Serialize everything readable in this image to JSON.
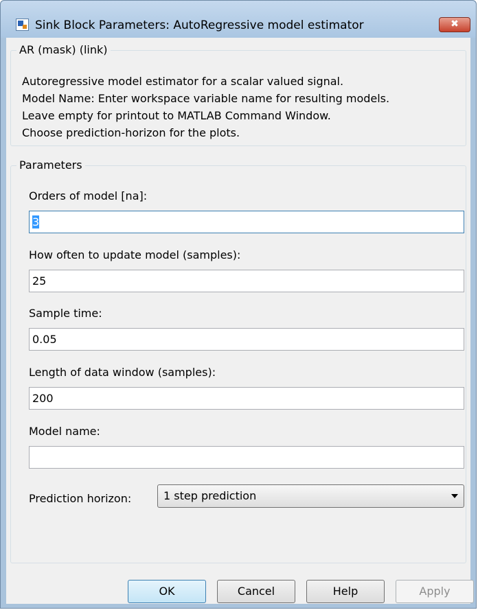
{
  "window": {
    "title": "Sink Block Parameters: AutoRegressive model estimator",
    "close_glyph": "✖"
  },
  "description_group": {
    "label": "AR (mask) (link)",
    "lines": [
      "Autoregressive model estimator for a scalar valued signal.",
      "Model Name: Enter workspace variable name for resulting models.",
      "Leave empty for printout to MATLAB Command Window.",
      "Choose prediction-horizon for the plots."
    ]
  },
  "parameters_group": {
    "label": "Parameters",
    "fields": [
      {
        "label": "Orders of model [na]:",
        "value": "3"
      },
      {
        "label": "How often to update model (samples):",
        "value": "25"
      },
      {
        "label": "Sample time:",
        "value": "0.05"
      },
      {
        "label": "Length of data window (samples):",
        "value": "200"
      },
      {
        "label": "Model name:",
        "value": ""
      }
    ],
    "prediction_horizon": {
      "label": "Prediction horizon:",
      "selected": "1 step prediction"
    }
  },
  "buttons": {
    "ok": "OK",
    "cancel": "Cancel",
    "help": "Help",
    "apply": "Apply"
  },
  "colors": {
    "accent": "#3399ff",
    "close_button": "#c7422d"
  },
  "icons": {
    "app": "simulink-block-icon",
    "close": "close-icon",
    "dropdown": "chevron-down-icon"
  }
}
